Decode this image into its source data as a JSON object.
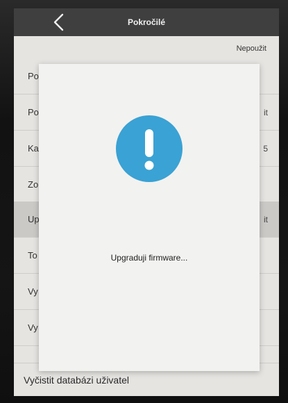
{
  "header": {
    "title": "Pokročilé",
    "back_icon": "chevron-left-icon"
  },
  "list": {
    "top_value": "Nepoužit",
    "rows": [
      {
        "label": "Po",
        "value": ""
      },
      {
        "label": "Po",
        "value": "it"
      },
      {
        "label": "Ka",
        "value": "5"
      },
      {
        "label": "Zo",
        "value": ""
      },
      {
        "label": "Up",
        "value": "it"
      },
      {
        "label": "To",
        "value": ""
      },
      {
        "label": "Vy",
        "value": ""
      },
      {
        "label": "Vy",
        "value": ""
      }
    ],
    "bottom_row_label": "Vyčistit databázi uživatel"
  },
  "dialog": {
    "icon": "exclamation-icon",
    "message": "Upgraduji firmware...",
    "icon_color": "#3aa2d4"
  },
  "colors": {
    "header_bg": "#3f3f3f",
    "screen_bg": "#e6e4e1",
    "dialog_bg": "#f2f2f0",
    "accent": "#3aa2d4"
  }
}
